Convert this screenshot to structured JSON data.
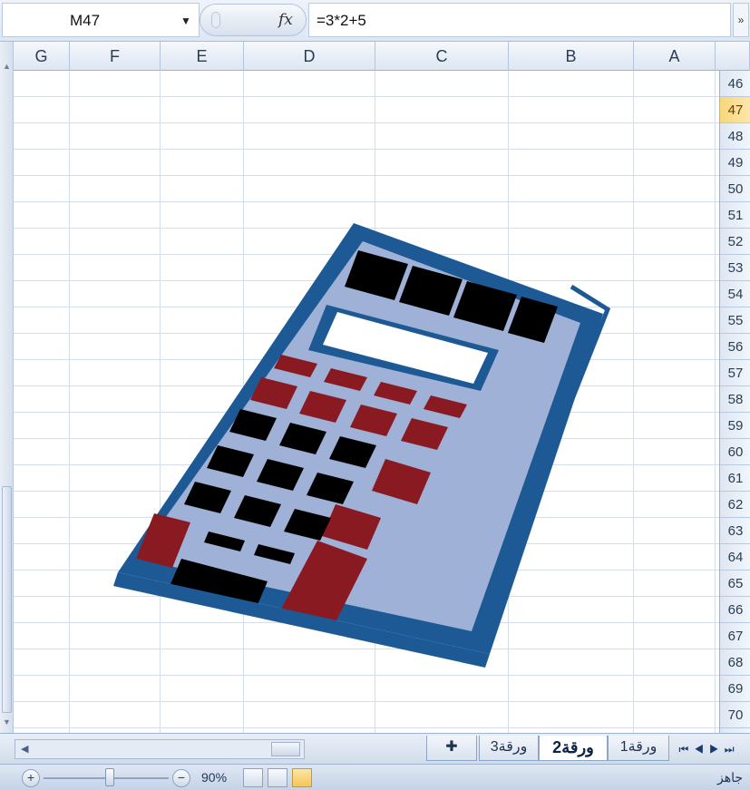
{
  "formula_bar": {
    "name_box": "M47",
    "fx_label": "fx",
    "formula": "=3*2+5"
  },
  "columns": [
    "G",
    "F",
    "E",
    "D",
    "C",
    "B",
    "A"
  ],
  "rows": [
    "46",
    "47",
    "48",
    "49",
    "50",
    "51",
    "52",
    "53",
    "54",
    "55",
    "56",
    "57",
    "58",
    "59",
    "60",
    "61",
    "62",
    "63",
    "64",
    "65",
    "66",
    "67",
    "68",
    "69",
    "70"
  ],
  "active_row": "47",
  "sheet_tabs": [
    {
      "label": "ورقة3",
      "active": false
    },
    {
      "label": "ورقة2",
      "active": true
    },
    {
      "label": "ورقة1",
      "active": false
    }
  ],
  "status_bar": {
    "zoom_out": "−",
    "zoom_in": "+",
    "zoom_level": "90%",
    "status": "جاهز"
  },
  "colors": {
    "calc_body": "#1d5a95",
    "calc_face": "#9fb1d6",
    "calc_red": "#8a1a22",
    "calc_keys": "#000000"
  }
}
